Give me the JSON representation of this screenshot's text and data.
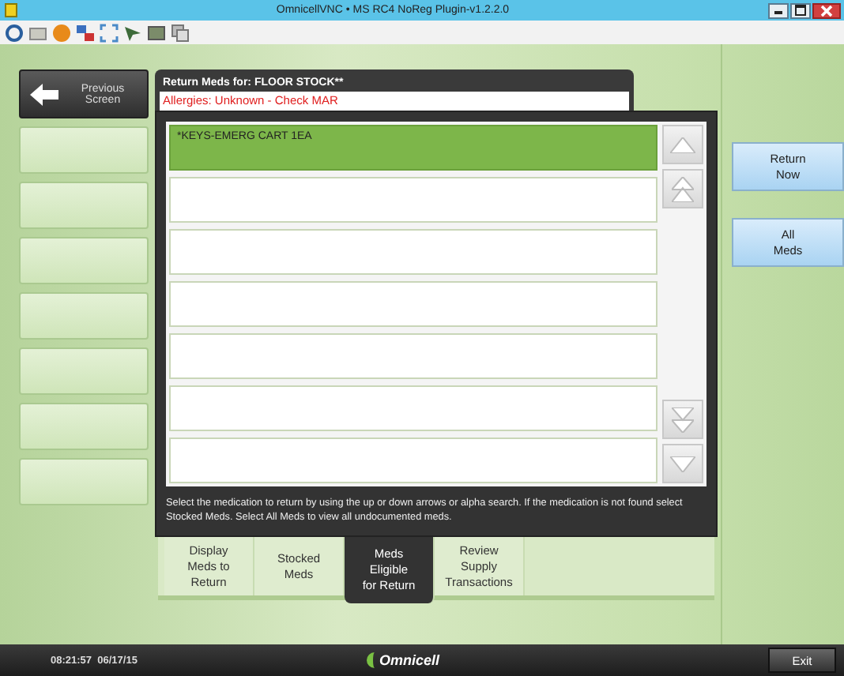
{
  "window": {
    "title": "OmnicellVNC  • MS RC4 NoReg Plugin-v1.2.2.0"
  },
  "previous_button": {
    "label": "Previous\nScreen"
  },
  "header": {
    "title": "Return Meds for: FLOOR STOCK**",
    "allergies": "Allergies: Unknown - Check MAR"
  },
  "med_rows": [
    {
      "text": "*KEYS-EMERG CART 1EA",
      "selected": true
    }
  ],
  "instructions": "Select the medication to return by using the up or down arrows or alpha search. If the medication is not found select Stocked Meds. Select All Meds to view all undocumented meds.",
  "tabs": [
    {
      "label": "Display\nMeds to\nReturn",
      "selected": false
    },
    {
      "label": "Stocked\nMeds",
      "selected": false
    },
    {
      "label": "Meds\nEligible\nfor Return",
      "selected": true
    },
    {
      "label": "Review\nSupply\nTransactions",
      "selected": false
    }
  ],
  "side_buttons": [
    {
      "label": "Return\nNow"
    },
    {
      "label": "All\nMeds"
    }
  ],
  "status_bar": {
    "datetime": "08:21:57  06/17/15",
    "logo": "Omnicell",
    "exit": "Exit"
  }
}
